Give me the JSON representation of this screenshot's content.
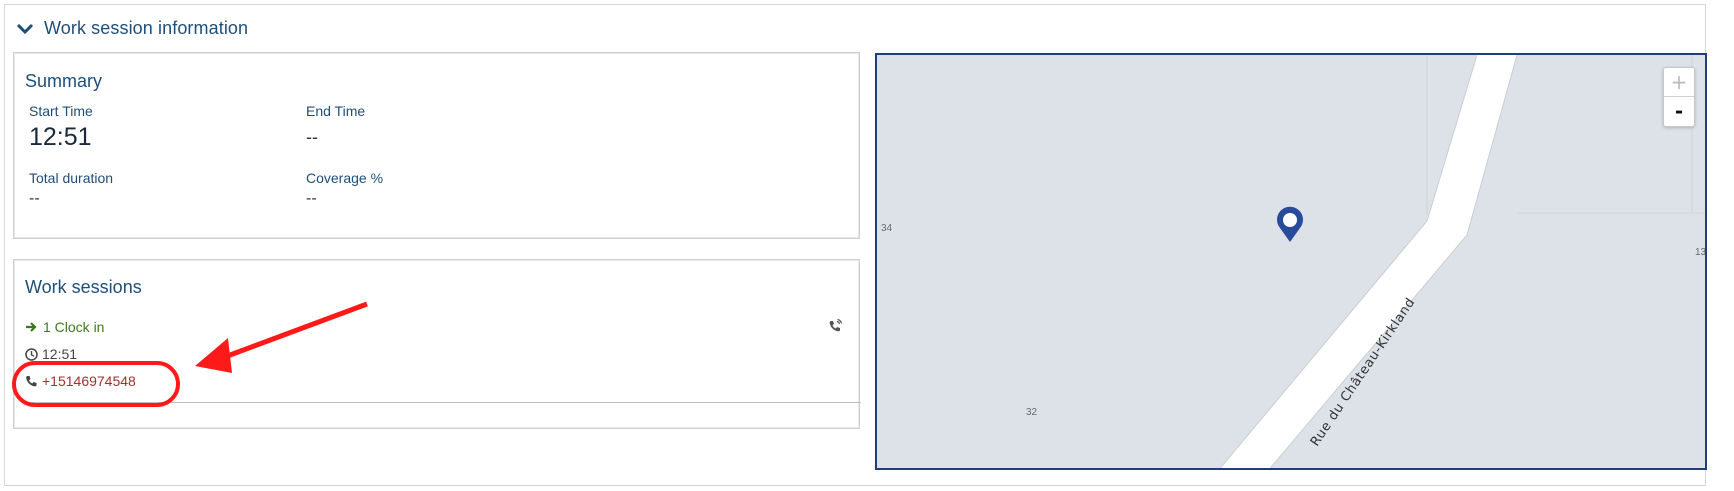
{
  "section": {
    "title": "Work session information",
    "toggle_icon": "chevron-down-icon"
  },
  "summary": {
    "title": "Summary",
    "start_time_label": "Start Time",
    "start_time_value": "12:51",
    "end_time_label": "End Time",
    "end_time_value": "--",
    "total_duration_label": "Total duration",
    "total_duration_value": "--",
    "coverage_label": "Coverage %",
    "coverage_value": "--"
  },
  "work_sessions": {
    "title": "Work sessions",
    "entry": {
      "clock_in_label": "1 Clock in",
      "time": "12:51",
      "phone": "+15146974548",
      "side_icon": "phone-volume-icon"
    }
  },
  "annotation": {
    "color": "#ff1a1a"
  },
  "map": {
    "street_name": "Rue du Château-Kirkland",
    "house_numbers": [
      "34",
      "32",
      "13"
    ],
    "zoom_in": "+",
    "zoom_out": "-",
    "marker_icon": "map-pin-icon",
    "colors": {
      "land": "#dde2e8",
      "road": "#ffffff",
      "marker": "#2a4b9b",
      "border": "#1f3f7a"
    }
  },
  "colors": {
    "heading": "#1f4e79",
    "clock_in": "#3a7a1a",
    "phone": "#a0322b"
  }
}
